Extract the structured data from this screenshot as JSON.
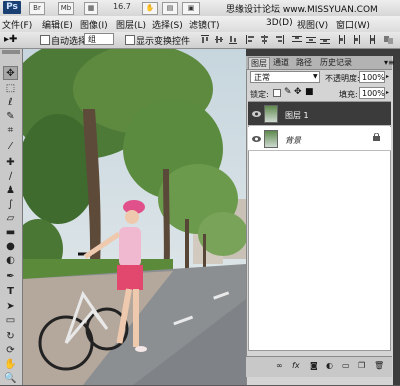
{
  "menubar": {
    "logo": "Ps",
    "btn_br": "Br",
    "btn_mb": "Mb",
    "zoom": "16.7",
    "menu_items": [
      "文件(F)",
      "编辑(E)",
      "图像(I)",
      "图层(L)",
      "选择(S)",
      "滤镜(T)",
      "3D(D)",
      "视图(V)",
      "窗口(W)"
    ],
    "watermark": "思缘设计论坛 www.MISSYUAN.COM"
  },
  "options": {
    "auto_select_label": "自动选择:",
    "auto_select_value": "组",
    "transform_label": "显示变换控件"
  },
  "layers_panel": {
    "tabs": [
      "图层",
      "通道",
      "路径",
      "历史记录"
    ],
    "active_tab": "图层",
    "blend_mode": "正常",
    "opacity_label": "不透明度:",
    "opacity_value": "100%",
    "lock_label": "锁定:",
    "fill_label": "填充:",
    "fill_value": "100%",
    "layers": [
      {
        "name": "图层 1",
        "selected": true,
        "locked": false
      },
      {
        "name": "背景",
        "selected": false,
        "locked": true
      }
    ]
  },
  "colors": {
    "selected_layer_bg": "#3b3b3b",
    "panel_bg": "#d4d4d4",
    "canvas_sky": "#9fb8c8"
  }
}
